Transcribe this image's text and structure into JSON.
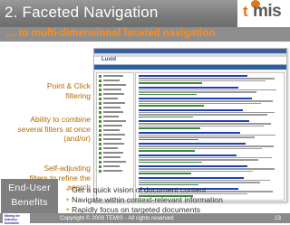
{
  "header": {
    "title": "2. Faceted Navigation",
    "logo_t": "t",
    "logo_mis": "mis"
  },
  "subheader": {
    "subtitle": "… to multi-dimensional faceted navigation"
  },
  "annotations": {
    "point_click": [
      "Point & Click",
      "filtering"
    ],
    "combine": [
      "Ability to combine",
      "several filters at once",
      "(and/or)"
    ],
    "self_adjust": [
      "Self-adjusting",
      "filters to refine the",
      "search"
    ]
  },
  "screenshot": {
    "app_logo": "Luxid"
  },
  "end_user_box": {
    "label_1": "End-User",
    "label_2": "Benefits"
  },
  "bullets": [
    "Get a quick vision of document content",
    "Navigate within context-relevant information",
    "Rapidly focus on targeted documents"
  ],
  "footer": {
    "badge_line1": "Mining for",
    "badge_line2": "Industry Solutions",
    "copyright": "Copyright © 2009 TEMIS - All rights reserved",
    "page_number": "13"
  },
  "colors": {
    "header_gray": "#8a8a8a",
    "accent_orange": "#ff8c1a",
    "annotation_orange": "#b36a00",
    "facet_green": "#4a8a3a",
    "result_link_blue": "#1f3fb5"
  }
}
